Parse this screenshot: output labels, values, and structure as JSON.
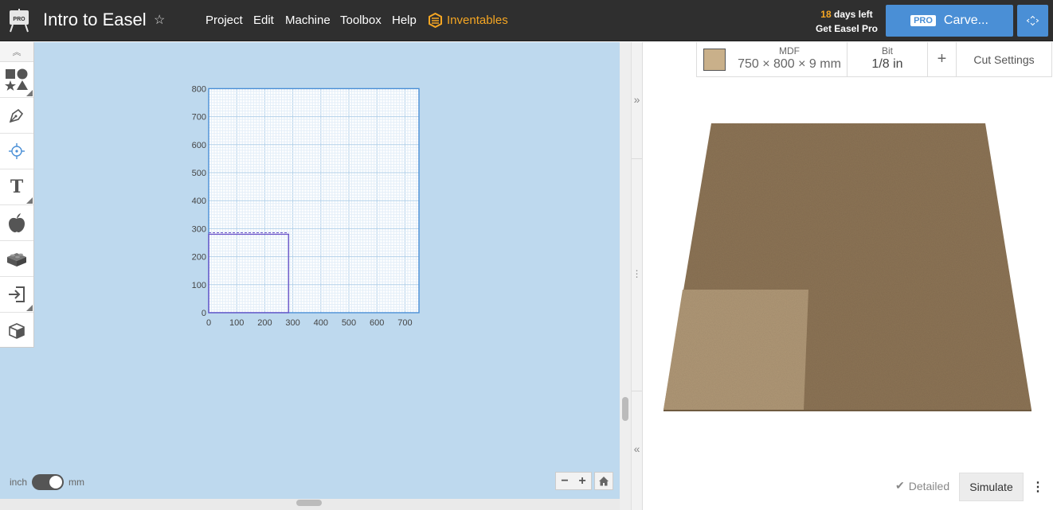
{
  "header": {
    "app_badge": "PRO",
    "title": "Intro to Easel",
    "menu": [
      "Project",
      "Edit",
      "Machine",
      "Toolbox",
      "Help"
    ],
    "inventables_label": "Inventables",
    "trial_days": "18",
    "trial_suffix": " days left",
    "trial_cta": "Get Easel Pro",
    "carve_badge": "PRO",
    "carve_label": "Carve...",
    "accent_color": "#4a8fd6",
    "highlight_color": "#f5a623"
  },
  "toolbar": {
    "tools": [
      "shapes-icon",
      "pen-icon",
      "target-icon",
      "text-icon",
      "apple-icon",
      "brick-icon",
      "import-icon",
      "cube-icon"
    ]
  },
  "design_grid": {
    "units": "mm",
    "x_ticks": [
      "0",
      "100",
      "200",
      "300",
      "400",
      "500",
      "600",
      "700"
    ],
    "y_ticks": [
      "0",
      "100",
      "200",
      "300",
      "400",
      "500",
      "600",
      "700",
      "800"
    ],
    "workpiece_width_mm": 750,
    "workpiece_height_mm": 800,
    "design_rect_mm": {
      "width": 285,
      "height": 280
    }
  },
  "units_toggle": {
    "left": "inch",
    "right": "mm",
    "selected": "mm"
  },
  "zoom": {
    "minus": "−",
    "plus": "+"
  },
  "material": {
    "name": "MDF",
    "dimensions": "750 × 800 × 9 mm",
    "swatch_color": "#c9b08a"
  },
  "bit": {
    "label": "Bit",
    "value": "1/8 in"
  },
  "add_label": "+",
  "cut_settings_label": "Cut Settings",
  "preview": {
    "detailed_label": "Detailed",
    "simulate_label": "Simulate",
    "more_label": "⋮"
  }
}
